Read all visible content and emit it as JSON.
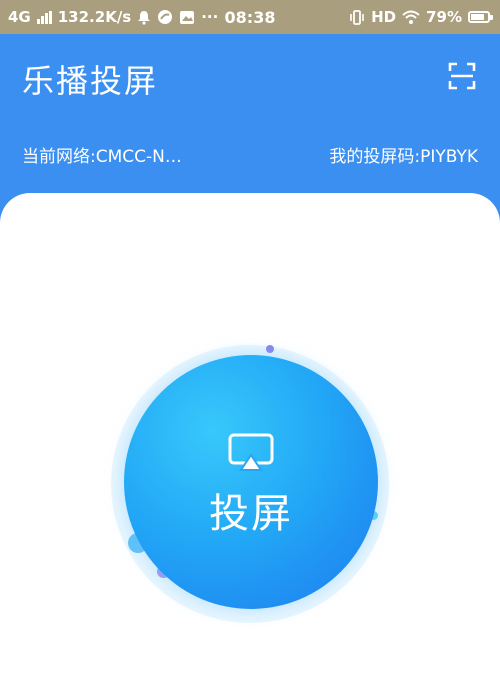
{
  "status_bar": {
    "network_type": "4G",
    "network_speed": "132.2K/s",
    "dots": "···",
    "time": "08:38",
    "hd_label": "HD",
    "battery_percent": "79%",
    "battery_level": 0.79
  },
  "header": {
    "title": "乐播投屏",
    "scan_icon": "scan-icon"
  },
  "info": {
    "network_label": "当前网络:CMCC-N…",
    "code_label": "我的投屏码:PIYBYK"
  },
  "cast": {
    "label": "投屏",
    "icon": "screen-cast-icon"
  },
  "colors": {
    "header_blue": "#3a8ff0",
    "status_bar": "#a99f7e",
    "button_light": "#38c8fb",
    "button_dark": "#237bee",
    "halo": "#e3f4fe"
  }
}
